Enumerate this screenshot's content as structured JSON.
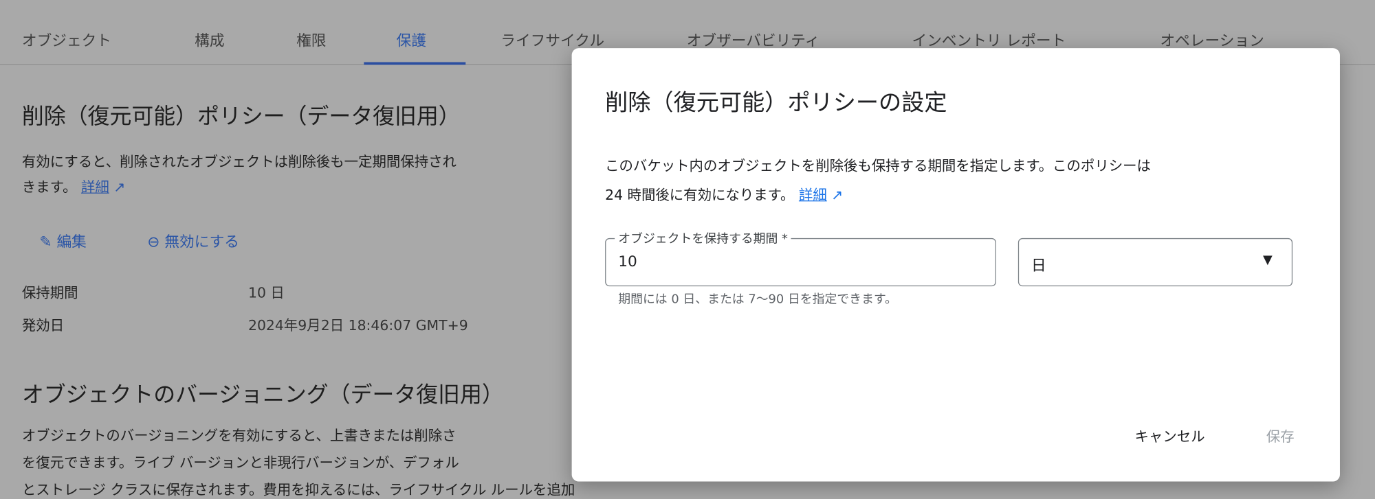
{
  "tabs": [
    {
      "label": "オブジェクト",
      "active": false
    },
    {
      "label": "構成",
      "active": false
    },
    {
      "label": "権限",
      "active": false
    },
    {
      "label": "保護",
      "active": true
    },
    {
      "label": "ライフサイクル",
      "active": false
    },
    {
      "label": "オブザーバビリティ",
      "active": false
    },
    {
      "label": "インベントリ レポート",
      "active": false
    },
    {
      "label": "オペレーション",
      "active": false
    }
  ],
  "soft_delete": {
    "title": "削除（復元可能）ポリシー（データ復旧用）",
    "desc_line1": "有効にすると、削除されたオブジェクトは削除後も一定期間保持され",
    "desc_line2": "きます。",
    "learn_more": "詳細",
    "edit_label": "編集",
    "disable_label": "無効にする",
    "retention_label": "保持期間",
    "retention_value": "10 日",
    "effective_label": "発効日",
    "effective_value": "2024年9月2日 18:46:07 GMT+9"
  },
  "versioning": {
    "title": "オブジェクトのバージョニング（データ復旧用）",
    "line1": "オブジェクトのバージョニングを有効にすると、上書きまたは削除さ",
    "line2": "を復元できます。ライブ バージョンと非現行バージョンが、デフォル",
    "line3": "とストレージ クラスに保存されます。費用を抑えるには、ライフサイクル ルールを追加"
  },
  "dialog": {
    "title": "削除（復元可能）ポリシーの設定",
    "desc_line1": "このバケット内のオブジェクトを削除後も保持する期間を指定します。このポリシーは",
    "desc_line2": "24 時間後に有効になります。",
    "learn_more": "詳細",
    "duration_label": "オブジェクトを保持する期間 *",
    "duration_value": "10",
    "unit_value": "日",
    "helper": "期間には 0 日、または 7〜90 日を指定できます。",
    "cancel_label": "キャンセル",
    "save_label": "保存",
    "save_disabled": true
  },
  "colors": {
    "accent": "#1a73e8",
    "scrim": "#a9a9a9"
  },
  "icons": {
    "edit": "pencil-icon",
    "disable": "minus-circle-icon",
    "external": "external-link-icon",
    "dropdown": "caret-down-icon"
  }
}
